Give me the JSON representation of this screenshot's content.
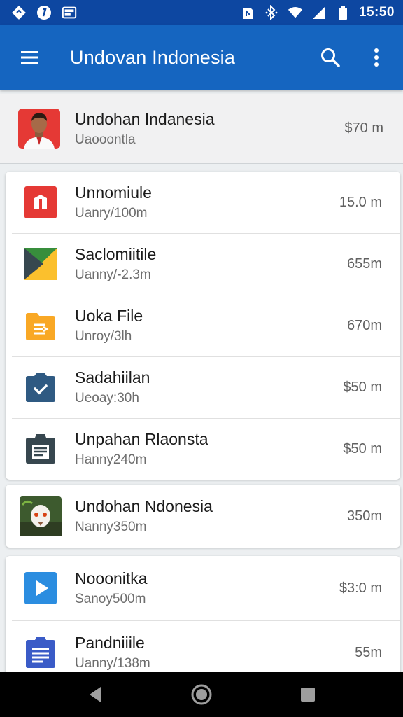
{
  "status_bar": {
    "time": "15:50"
  },
  "app_bar": {
    "title": "Undovan Indonesia"
  },
  "header_item": {
    "name": "Undohan Indanesia",
    "sub": "Uaooontla",
    "size": "$70 m"
  },
  "list_group_1": [
    {
      "name": "Unnomiule",
      "sub": "Uanry/100m",
      "size": "15.0 m",
      "icon": "file-red-icon",
      "color": "#e53935"
    },
    {
      "name": "Saclomiitile",
      "sub": "Uanny/-2.3m",
      "size": "655m",
      "icon": "slides-yellow-icon",
      "color": "#fbc02d"
    },
    {
      "name": "Uoka File",
      "sub": "Unroy/3lh",
      "size": "670m",
      "icon": "folder-orange-icon",
      "color": "#f9a825"
    },
    {
      "name": "Sadahiilan",
      "sub": "Ueoay:30h",
      "size": "$50 m",
      "icon": "camera-blue-icon",
      "color": "#2f5a82"
    },
    {
      "name": "Unpahan Rlaonsta",
      "sub": "Hanny240m",
      "size": "$50 m",
      "icon": "clipboard-dark-icon",
      "color": "#37474f"
    },
    {
      "name": "Undohan Ndonesia",
      "sub": "Nanny350m",
      "size": "350m",
      "icon": "photo-thumbnail",
      "color": "#4a6a3a"
    }
  ],
  "list_group_2": [
    {
      "name": "Nooonitka",
      "sub": "Sanoy500m",
      "size": "$3:0 m",
      "icon": "play-blue-icon",
      "color": "#2b8de0"
    },
    {
      "name": "Pandniiile",
      "sub": "Uanny/138m",
      "size": "55m",
      "icon": "doc-blue-icon",
      "color": "#3a5bc7"
    }
  ]
}
